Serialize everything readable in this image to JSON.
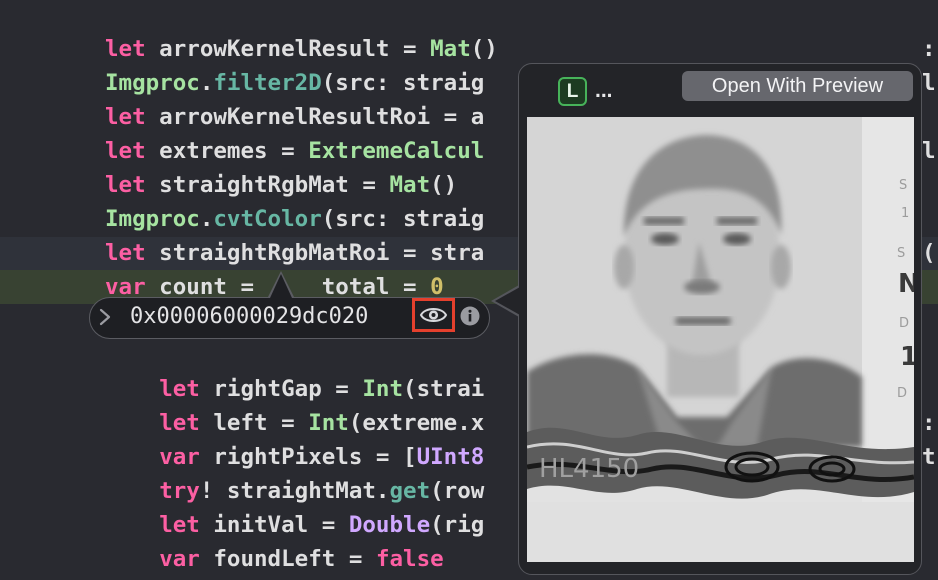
{
  "code": {
    "lines": [
      [
        {
          "t": "let",
          "c": "keyword"
        },
        {
          "t": " arrowKernelResult = ",
          "c": "plain"
        },
        {
          "t": "Mat",
          "c": "type"
        },
        {
          "t": "()",
          "c": "plain"
        }
      ],
      [
        {
          "t": "Imgproc",
          "c": "type"
        },
        {
          "t": ".",
          "c": "plain"
        },
        {
          "t": "filter2D",
          "c": "method"
        },
        {
          "t": "(src: straig",
          "c": "plain"
        }
      ],
      [
        {
          "t": "let",
          "c": "keyword"
        },
        {
          "t": " arrowKernelResultRoi = a",
          "c": "plain"
        }
      ],
      [
        {
          "t": "let",
          "c": "keyword"
        },
        {
          "t": " extremes = ",
          "c": "plain"
        },
        {
          "t": "ExtremeCalcul",
          "c": "type"
        }
      ],
      [
        {
          "t": "let",
          "c": "keyword"
        },
        {
          "t": " straightRgbMat = ",
          "c": "plain"
        },
        {
          "t": "Mat",
          "c": "type"
        },
        {
          "t": "()",
          "c": "plain"
        }
      ],
      [
        {
          "t": "Imgproc",
          "c": "type"
        },
        {
          "t": ".",
          "c": "plain"
        },
        {
          "t": "cvtColor",
          "c": "method"
        },
        {
          "t": "(src: straig",
          "c": "plain"
        }
      ],
      [
        {
          "t": "let",
          "c": "keyword"
        },
        {
          "t": " straightRgbMatRoi = stra",
          "c": "plain"
        }
      ],
      [
        {
          "t": "var",
          "c": "keyword"
        },
        {
          "t": " count =     total = ",
          "c": "plain"
        },
        {
          "t": "0",
          "c": "number"
        }
      ],
      [],
      [],
      [
        {
          "t": "    ",
          "c": "plain"
        },
        {
          "t": "let",
          "c": "keyword"
        },
        {
          "t": " rightGap = ",
          "c": "plain"
        },
        {
          "t": "Int",
          "c": "type"
        },
        {
          "t": "(strai",
          "c": "plain"
        }
      ],
      [
        {
          "t": "    ",
          "c": "plain"
        },
        {
          "t": "let",
          "c": "keyword"
        },
        {
          "t": " left = ",
          "c": "plain"
        },
        {
          "t": "Int",
          "c": "type"
        },
        {
          "t": "(extreme.x",
          "c": "plain"
        }
      ],
      [
        {
          "t": "    ",
          "c": "plain"
        },
        {
          "t": "var",
          "c": "keyword"
        },
        {
          "t": " rightPixels = [",
          "c": "plain"
        },
        {
          "t": "UInt8",
          "c": "type2"
        }
      ],
      [
        {
          "t": "    ",
          "c": "plain"
        },
        {
          "t": "try",
          "c": "keyword"
        },
        {
          "t": "! straightMat.",
          "c": "plain"
        },
        {
          "t": "get",
          "c": "method"
        },
        {
          "t": "(row",
          "c": "plain"
        }
      ],
      [
        {
          "t": "    ",
          "c": "plain"
        },
        {
          "t": "let",
          "c": "keyword"
        },
        {
          "t": " initVal = ",
          "c": "plain"
        },
        {
          "t": "Double",
          "c": "type2"
        },
        {
          "t": "(rig",
          "c": "plain"
        }
      ],
      [
        {
          "t": "    ",
          "c": "plain"
        },
        {
          "t": "var",
          "c": "keyword"
        },
        {
          "t": " foundLeft = ",
          "c": "plain"
        },
        {
          "t": "false",
          "c": "keyword"
        }
      ]
    ],
    "right_fragments": [
      ":",
      "l",
      "",
      "l",
      "",
      "",
      "(",
      "",
      "",
      "",
      "",
      ":",
      "t",
      "",
      "",
      ""
    ]
  },
  "colors": {
    "keyword": "#fc5fa3",
    "type": "#a6e3a1",
    "type2": "#d0a8ff",
    "method": "#67b7a4",
    "number": "#d0bf69",
    "plain": "#dfdfe0",
    "highlight_border": "#e5402d"
  },
  "debugger": {
    "pointer_value": "0x00006000029dc020",
    "disclosure_icon": "chevron-right-icon",
    "quicklook_icon": "eye-icon",
    "info_icon": "info-circle-icon"
  },
  "quicklook": {
    "type_badge": "L",
    "variable_name": "...",
    "open_button_label": "Open With Preview",
    "image_icon": "grayscale-portrait-photo"
  }
}
